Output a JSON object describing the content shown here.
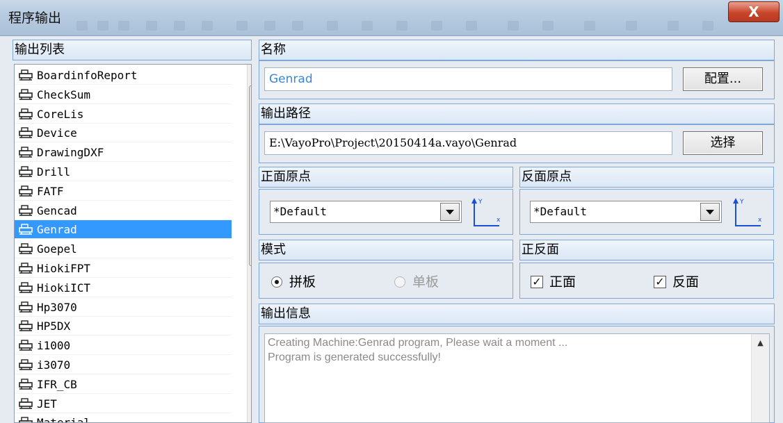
{
  "window": {
    "title": "程序输出",
    "close_glyph": "X"
  },
  "output_list": {
    "header": "输出列表",
    "items": [
      "BoardinfoReport",
      "CheckSum",
      "CoreLis",
      "Device",
      "DrawingDXF",
      "Drill",
      "FATF",
      "Gencad",
      "Genrad",
      "Goepel",
      "HiokiFPT",
      "HiokiICT",
      "Hp3070",
      "HP5DX",
      "i1000",
      "i3070",
      "IFR_CB",
      "JET",
      "Material"
    ],
    "selected_index": 8,
    "scroll_up_glyph": "▲",
    "scroll_grip_glyph": "≡"
  },
  "name_section": {
    "header": "名称",
    "value": "Genrad",
    "config_button": "配置..."
  },
  "path_section": {
    "header": "输出路径",
    "value": "E:\\VayoPro\\Project\\20150414a.vayo\\Genrad",
    "select_button": "选择"
  },
  "front_origin": {
    "header": "正面原点",
    "selected": "*Default",
    "axis_y": "Y",
    "axis_x": "x"
  },
  "back_origin": {
    "header": "反面原点",
    "selected": "*Default",
    "axis_y": "Y",
    "axis_x": "x"
  },
  "mode": {
    "header": "模式",
    "options": [
      {
        "label": "拼板",
        "checked": true,
        "enabled": true
      },
      {
        "label": "单板",
        "checked": false,
        "enabled": false
      }
    ]
  },
  "sides": {
    "header": "正反面",
    "options": [
      {
        "label": "正面",
        "checked": true
      },
      {
        "label": "反面",
        "checked": true
      }
    ],
    "check_glyph": "✓"
  },
  "output_info": {
    "header": "输出信息",
    "lines": [
      "Creating Machine:Genrad program, Please wait a moment ...",
      "Program is generated successfully!"
    ],
    "scroll_up_glyph": "▲"
  },
  "colors": {
    "selection": "#3399ff",
    "group_border": "#7ea7d8",
    "name_text": "#3b86d6"
  }
}
